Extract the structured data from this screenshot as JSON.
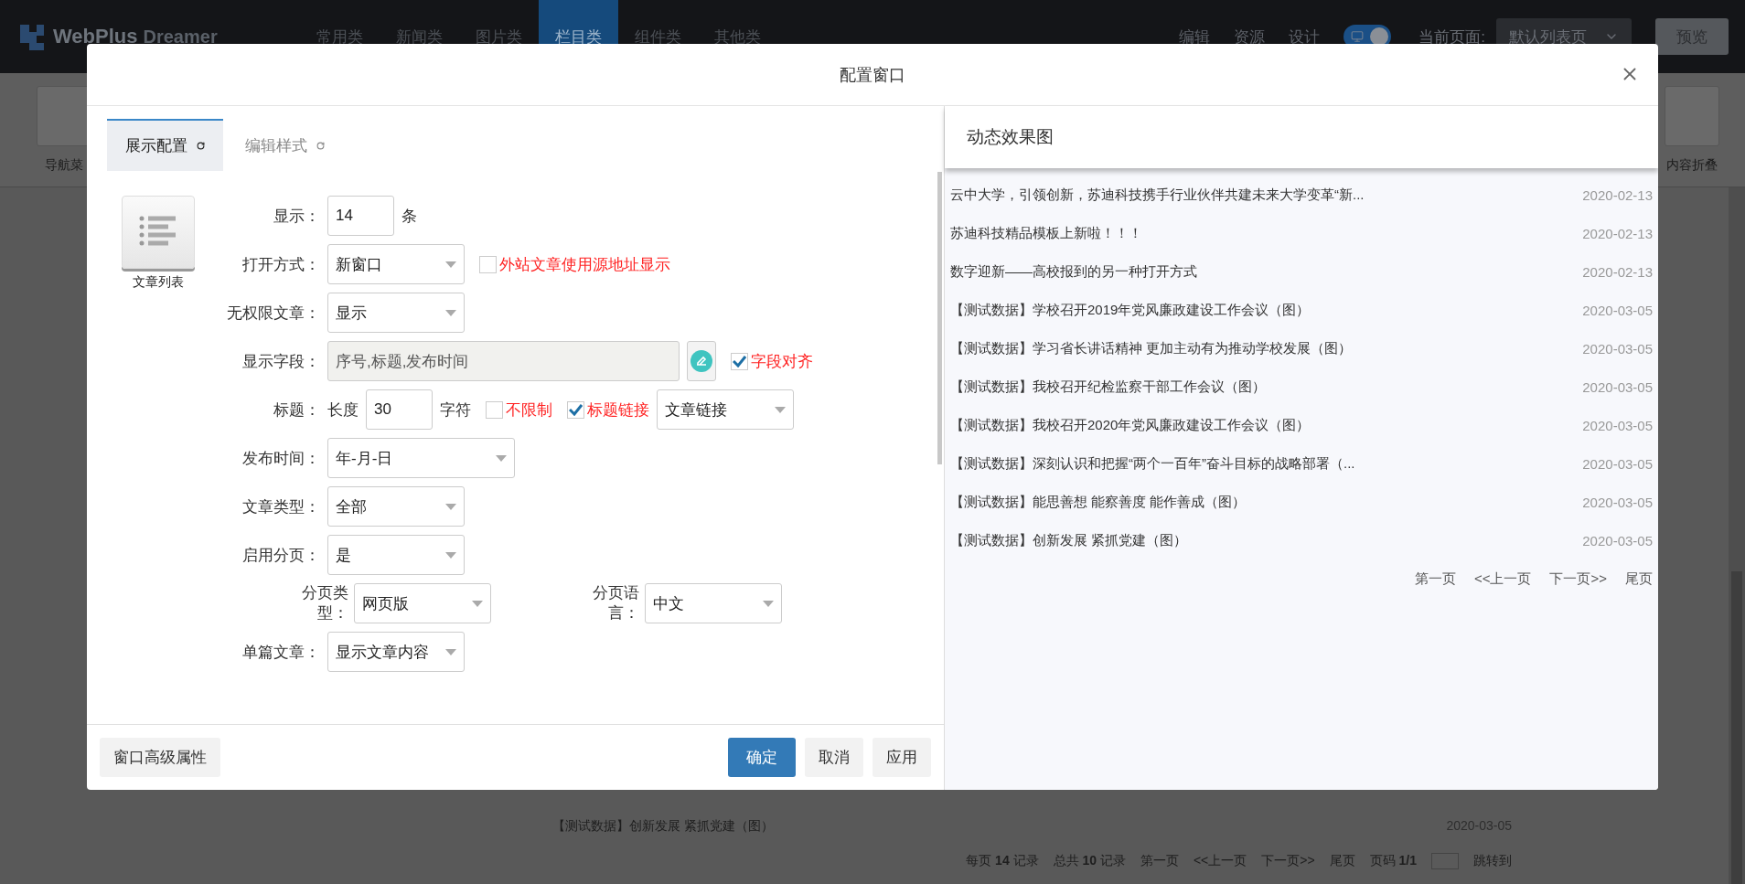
{
  "app_header": {
    "logo_text": "WebPlus",
    "logo_subtext": "Dreamer",
    "nav": [
      {
        "label": "常用类",
        "selected": false
      },
      {
        "label": "新闻类",
        "selected": false
      },
      {
        "label": "图片类",
        "selected": false
      },
      {
        "label": "栏目类",
        "selected": true
      },
      {
        "label": "组件类",
        "selected": false
      },
      {
        "label": "其他类",
        "selected": false
      }
    ],
    "actions": [
      "编辑",
      "资源",
      "设计"
    ],
    "design_toggle": {
      "on": true
    },
    "current_page_label": "当前页面:",
    "current_page_value": "默认列表页",
    "preview_button": "预览"
  },
  "component_strip": [
    {
      "label": "导航菜"
    },
    {
      "label": "内容折叠"
    }
  ],
  "background_list": {
    "rows": [
      {
        "title": "【测试数据】创新发展 紧抓党建（图）",
        "date": "2020-03-05"
      }
    ],
    "pager": [
      {
        "kind": "text",
        "text": "每页 **14** 记录"
      },
      {
        "kind": "text",
        "text": "总共 **10** 记录"
      },
      {
        "kind": "link",
        "text": "第一页"
      },
      {
        "kind": "link",
        "text": "<<上一页"
      },
      {
        "kind": "link",
        "text": "下一页>>"
      },
      {
        "kind": "link",
        "text": "尾页"
      },
      {
        "kind": "text",
        "text": "页码 **1/1**"
      },
      {
        "kind": "input"
      },
      {
        "kind": "link",
        "text": "跳转到"
      }
    ]
  },
  "dialog": {
    "title": "配置窗口",
    "tabs": [
      {
        "label": "展示配置",
        "selected": true
      },
      {
        "label": "编辑样式",
        "selected": false
      }
    ],
    "widget": {
      "label": "文章列表"
    },
    "form": [
      {
        "kind": "row",
        "label": "显示：",
        "controls": [
          {
            "kind": "input",
            "value": "14"
          },
          {
            "kind": "text",
            "text": "条"
          }
        ]
      },
      {
        "kind": "row",
        "label": "打开方式：",
        "controls": [
          {
            "kind": "select",
            "value": "新窗口"
          },
          {
            "kind": "checkbox",
            "label": "外站文章使用源地址显示",
            "checked": false
          }
        ]
      },
      {
        "kind": "row",
        "label": "无权限文章：",
        "controls": [
          {
            "kind": "select",
            "value": "显示"
          }
        ]
      },
      {
        "kind": "row",
        "label": "显示字段：",
        "controls": [
          {
            "kind": "field",
            "value": "序号,标题,发布时间",
            "disabled": true
          },
          {
            "kind": "edit_button"
          },
          {
            "kind": "checkbox",
            "label": "字段对齐",
            "checked": true
          }
        ]
      },
      {
        "kind": "row",
        "label": "标题：",
        "controls": [
          {
            "kind": "text",
            "text": "长度"
          },
          {
            "kind": "input",
            "value": "30"
          },
          {
            "kind": "text",
            "text": "字符"
          },
          {
            "kind": "checkbox",
            "label": "不限制",
            "checked": false
          },
          {
            "kind": "checkbox",
            "label": "标题链接",
            "checked": true
          },
          {
            "kind": "select",
            "value": "文章链接"
          }
        ]
      },
      {
        "kind": "row",
        "label": "发布时间：",
        "controls": [
          {
            "kind": "format_select",
            "value": "年-月-日"
          }
        ]
      },
      {
        "kind": "row",
        "label": "文章类型：",
        "controls": [
          {
            "kind": "select",
            "value": "全部"
          }
        ]
      },
      {
        "kind": "row",
        "label": "启用分页：",
        "controls": [
          {
            "kind": "select",
            "value": "是"
          }
        ]
      },
      {
        "kind": "pair",
        "items": [
          {
            "label": "分页类型：",
            "value": "网页版"
          },
          {
            "label": "分页语言：",
            "value": "中文"
          }
        ]
      },
      {
        "kind": "row",
        "label": "单篇文章：",
        "controls": [
          {
            "kind": "select",
            "value": "显示文章内容"
          }
        ]
      }
    ],
    "footer": {
      "advanced_button": "窗口高级属性",
      "buttons": [
        {
          "label": "确定",
          "kind": "primary"
        },
        {
          "label": "取消",
          "kind": "default"
        },
        {
          "label": "应用",
          "kind": "default"
        }
      ]
    },
    "preview": {
      "title": "动态效果图",
      "items": [
        {
          "title": "云中大学，引领创新，苏迪科技携手行业伙伴共建未来大学变革“新...",
          "date": "2020-02-13"
        },
        {
          "title": "苏迪科技精品模板上新啦！！！",
          "date": "2020-02-13"
        },
        {
          "title": "数字迎新——高校报到的另一种打开方式",
          "date": "2020-02-13"
        },
        {
          "title": "【测试数据】学校召开2019年党风廉政建设工作会议（图）",
          "date": "2020-03-05"
        },
        {
          "title": "【测试数据】学习省长讲话精神 更加主动有为推动学校发展（图）",
          "date": "2020-03-05"
        },
        {
          "title": "【测试数据】我校召开纪检监察干部工作会议（图）",
          "date": "2020-03-05"
        },
        {
          "title": "【测试数据】我校召开2020年党风廉政建设工作会议（图）",
          "date": "2020-03-05"
        },
        {
          "title": "【测试数据】深刻认识和把握“两个一百年”奋斗目标的战略部署（...",
          "date": "2020-03-05"
        },
        {
          "title": "【测试数据】能思善想 能察善度 能作善成（图）",
          "date": "2020-03-05"
        },
        {
          "title": "【测试数据】创新发展 紧抓党建（图）",
          "date": "2020-03-05"
        }
      ],
      "pager": [
        "第一页",
        "<<上一页",
        "下一页>>",
        "尾页"
      ]
    }
  }
}
